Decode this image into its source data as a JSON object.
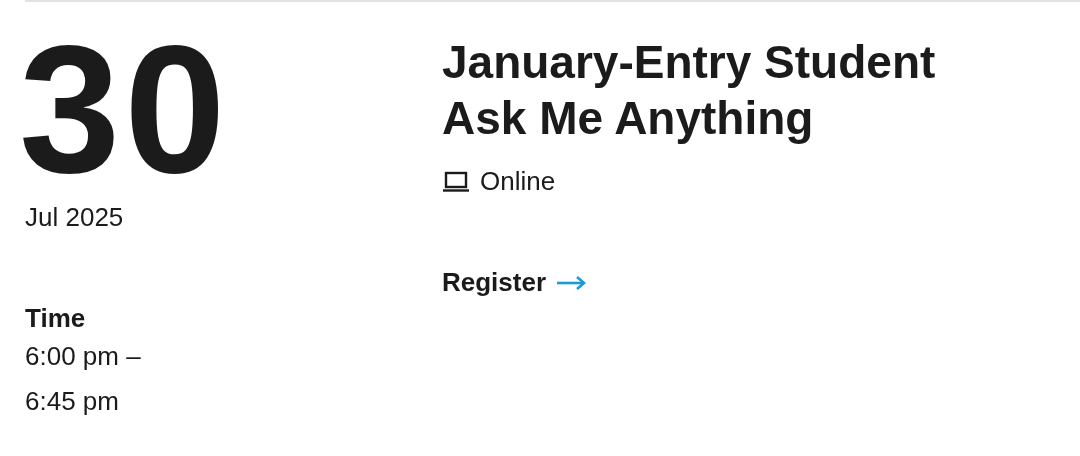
{
  "date": {
    "day": "30",
    "month_year": "Jul 2025"
  },
  "time": {
    "label": "Time",
    "lines": [
      "6:00 pm –",
      "6:45 pm"
    ]
  },
  "event": {
    "title_lines": [
      "January-Entry Student",
      "Ask Me Anything"
    ],
    "location": "Online",
    "register_link": "Register"
  }
}
